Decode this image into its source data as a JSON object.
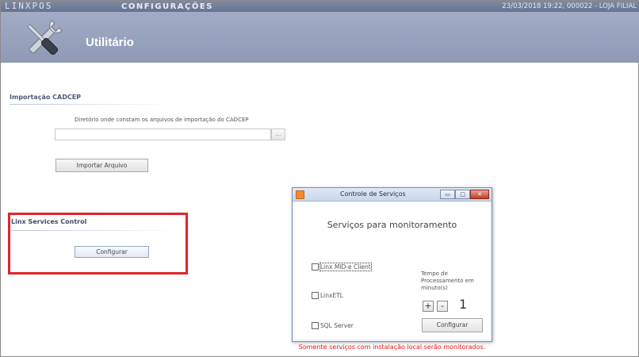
{
  "topbar": {
    "logo": "LINXPOS",
    "section": "CONFIGURAÇÕES",
    "status": "23/03/2018 19:22, 000022 - LOJA FILIAL"
  },
  "header": {
    "icon": "tools-icon",
    "title": "Utilitário"
  },
  "cadcep": {
    "group_title": "Importação CADCEP",
    "directory_label": "Diretório onde constam os arquivos de importação do CADCEP",
    "directory_value": "",
    "browse_label": "...",
    "import_button": "Importar Arquivo"
  },
  "services_control": {
    "group_title": "Linx Services Control",
    "configure_button": "Configurar",
    "highlight_color": "#e0242b"
  },
  "dialog": {
    "title": "Controle de Serviços",
    "heading": "Serviços para monitoramento",
    "services": [
      {
        "label": "Linx MID-e Client",
        "checked": false
      },
      {
        "label": "LinxETL",
        "checked": false
      },
      {
        "label": "SQL Server",
        "checked": false
      }
    ],
    "tempo_label": "Tempo de Processamento em minuto(s)",
    "plus_label": "+",
    "minus_label": "-",
    "tempo_value": "1",
    "configure_button": "Configurar",
    "note": "Somente serviços com instalação local serão monitorados.",
    "window_buttons": {
      "minimize": "▭",
      "maximize": "□",
      "close": "✕"
    }
  }
}
